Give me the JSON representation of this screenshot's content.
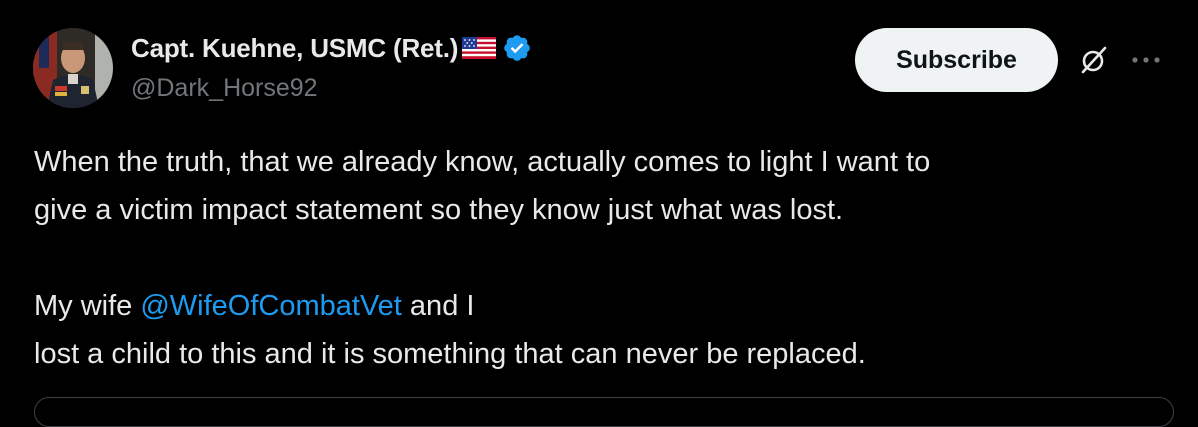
{
  "tweet": {
    "author": {
      "display_name": "Capt. Kuehne, USMC (Ret.)",
      "handle": "@Dark_Horse92",
      "avatar_icon": "avatar-photo",
      "flag_icon": "us-flag-emoji",
      "verified_icon": "verified-badge",
      "verified_color": "#1d9bf0"
    },
    "actions": {
      "subscribe_label": "Subscribe",
      "grok_icon": "grok-icon",
      "more_icon": "more-icon"
    },
    "body": {
      "line1": "When the truth, that we already know, actually comes to light I want to",
      "line2": "give a victim impact statement so they know just what was lost.",
      "line3_prefix": "My wife ",
      "mention": "@WifeOfCombatVet",
      "line3_suffix": " and I",
      "line4": "lost a child to this and it is something that can never be replaced."
    },
    "colors": {
      "background": "#000000",
      "text": "#e7e9ea",
      "secondary_text": "#71767b",
      "link": "#1d9bf0",
      "button_bg": "#eff3f4"
    }
  }
}
